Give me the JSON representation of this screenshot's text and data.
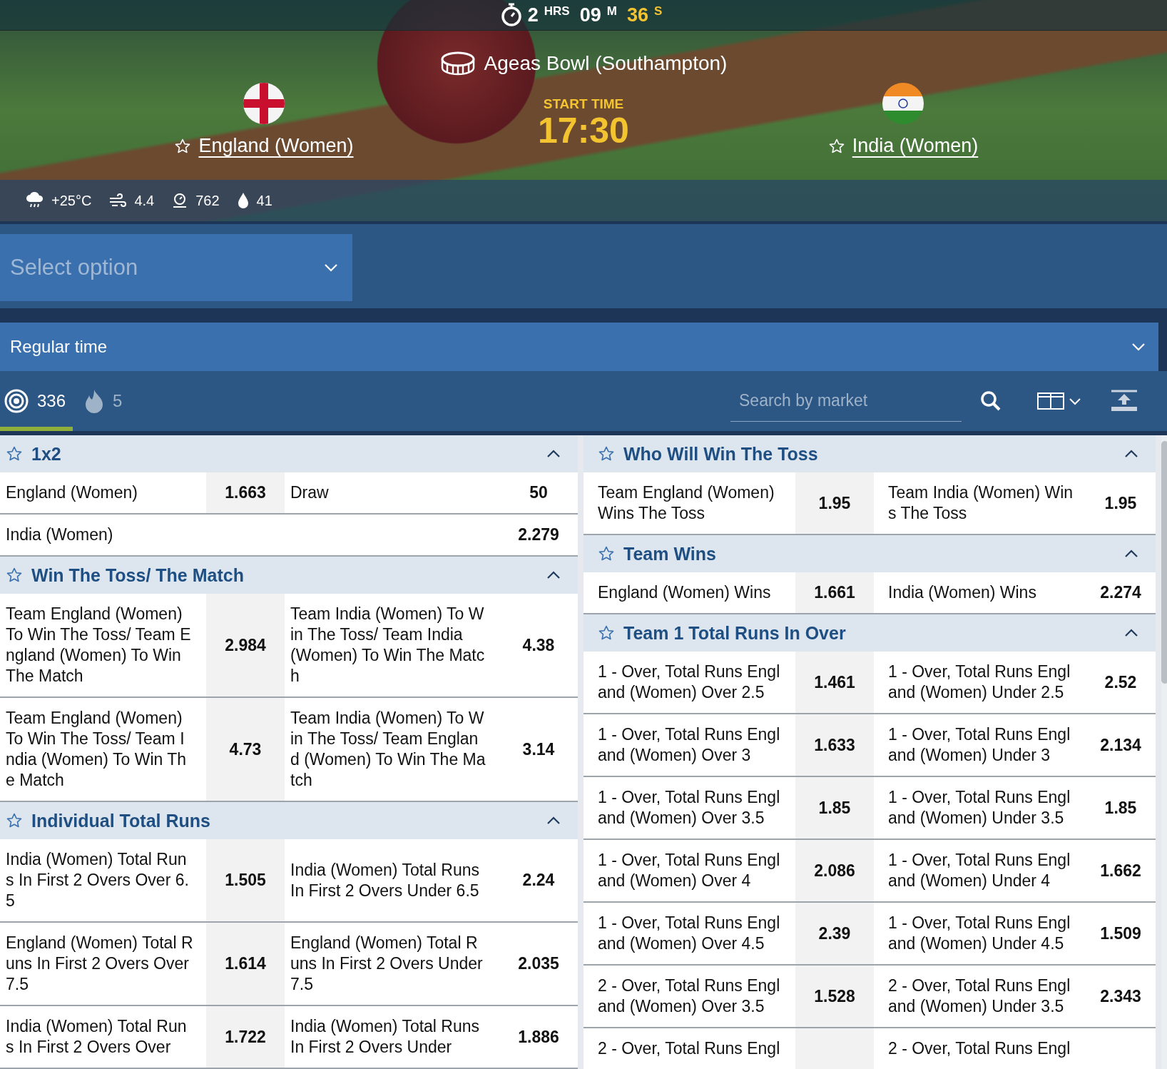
{
  "header": {
    "countdown": [
      {
        "value": "2",
        "unit": "HRS",
        "highlight": false
      },
      {
        "value": "09",
        "unit": "M",
        "highlight": false
      },
      {
        "value": "36",
        "unit": "S",
        "highlight": true
      }
    ],
    "venue": "Ageas Bowl (Southampton)",
    "start_time_label": "START TIME",
    "start_time": "17:30",
    "teams": [
      {
        "name": "England (Women)",
        "favorite": false
      },
      {
        "name": "India (Women)",
        "favorite": false
      }
    ],
    "weather": [
      {
        "kind": "rain",
        "value": "+25°C"
      },
      {
        "kind": "wind",
        "value": "4.4"
      },
      {
        "kind": "pressure",
        "value": "762"
      },
      {
        "kind": "humidity",
        "value": "41"
      }
    ]
  },
  "option_select": {
    "placeholder": "Select option"
  },
  "period_select": {
    "value": "Regular time"
  },
  "toolbar": {
    "tabs": [
      {
        "kind": "all",
        "count": "336",
        "selected": true
      },
      {
        "kind": "hot",
        "count": "5",
        "selected": false
      }
    ],
    "search": {
      "placeholder": "Search by market"
    }
  },
  "markets_left": [
    {
      "title": "1x2",
      "expanded": true,
      "rows": [
        {
          "cells": [
            {
              "label": "England (Women)",
              "odds": "1.663"
            },
            {
              "label": "Draw",
              "odds": "50"
            }
          ]
        },
        {
          "cells": [
            {
              "label": "India (Women)",
              "odds": "2.279"
            }
          ]
        }
      ]
    },
    {
      "title": "Win The Toss/ The Match",
      "expanded": true,
      "rows": [
        {
          "cells": [
            {
              "label": "Team England (Women) To Win The Toss/ Team England (Women) To Win The Match",
              "odds": "2.984"
            },
            {
              "label": "Team India (Women) To Win The Toss/ Team India (Women) To Win The Match",
              "odds": "4.38"
            }
          ]
        },
        {
          "cells": [
            {
              "label": "Team England (Women) To Win The Toss/ Team India (Women) To Win The Match",
              "odds": "4.73"
            },
            {
              "label": "Team India (Women) To Win The Toss/ Team England (Women) To Win The Match",
              "odds": "3.14"
            }
          ]
        }
      ]
    },
    {
      "title": "Individual Total Runs",
      "expanded": true,
      "rows": [
        {
          "cells": [
            {
              "label": "India (Women) Total Runs In First 2 Overs Over 6.5",
              "odds": "1.505"
            },
            {
              "label": "India (Women) Total Runs In First 2 Overs Under 6.5",
              "odds": "2.24"
            }
          ]
        },
        {
          "cells": [
            {
              "label": "England (Women) Total Runs In First 2 Overs Over 7.5",
              "odds": "1.614"
            },
            {
              "label": "England (Women) Total Runs In First 2 Overs Under 7.5",
              "odds": "2.035"
            }
          ]
        },
        {
          "cells": [
            {
              "label": "India (Women) Total Runs In First 2 Overs Over",
              "odds": "1.722"
            },
            {
              "label": "India (Women) Total Runs In First 2 Overs Under",
              "odds": "1.886"
            }
          ]
        }
      ]
    }
  ],
  "markets_right": [
    {
      "title": "Who Will Win The Toss",
      "expanded": true,
      "rows": [
        {
          "cells": [
            {
              "label": "Team England (Women) Wins The Toss",
              "odds": "1.95"
            },
            {
              "label": "Team India (Women) Wins The Toss",
              "odds": "1.95"
            }
          ]
        }
      ]
    },
    {
      "title": "Team Wins",
      "expanded": true,
      "rows": [
        {
          "cells": [
            {
              "label": "England (Women) Wins",
              "odds": "1.661"
            },
            {
              "label": "India (Women) Wins",
              "odds": "2.274"
            }
          ]
        }
      ]
    },
    {
      "title": "Team 1 Total Runs In Over",
      "expanded": true,
      "rows": [
        {
          "cells": [
            {
              "label": "1 - Over, Total Runs England (Women) Over 2.5",
              "odds": "1.461"
            },
            {
              "label": "1 - Over, Total Runs England (Women) Under 2.5",
              "odds": "2.52"
            }
          ]
        },
        {
          "cells": [
            {
              "label": "1 - Over, Total Runs England (Women) Over 3",
              "odds": "1.633"
            },
            {
              "label": "1 - Over, Total Runs England (Women) Under 3",
              "odds": "2.134"
            }
          ]
        },
        {
          "cells": [
            {
              "label": "1 - Over, Total Runs England (Women) Over 3.5",
              "odds": "1.85"
            },
            {
              "label": "1 - Over, Total Runs England (Women) Under 3.5",
              "odds": "1.85"
            }
          ]
        },
        {
          "cells": [
            {
              "label": "1 - Over, Total Runs England (Women) Over 4",
              "odds": "2.086"
            },
            {
              "label": "1 - Over, Total Runs England (Women) Under 4",
              "odds": "1.662"
            }
          ]
        },
        {
          "cells": [
            {
              "label": "1 - Over, Total Runs England (Women) Over 4.5",
              "odds": "2.39"
            },
            {
              "label": "1 - Over, Total Runs England (Women) Under 4.5",
              "odds": "1.509"
            }
          ]
        },
        {
          "cells": [
            {
              "label": "2 - Over, Total Runs England (Women) Over 3.5",
              "odds": "1.528"
            },
            {
              "label": "2 - Over, Total Runs England (Women) Under 3.5",
              "odds": "2.343"
            }
          ]
        },
        {
          "cells": [
            {
              "label": "2 - Over, Total Runs Engl"
            },
            {
              "label": "2 - Over, Total Runs Engl"
            }
          ]
        }
      ]
    }
  ]
}
